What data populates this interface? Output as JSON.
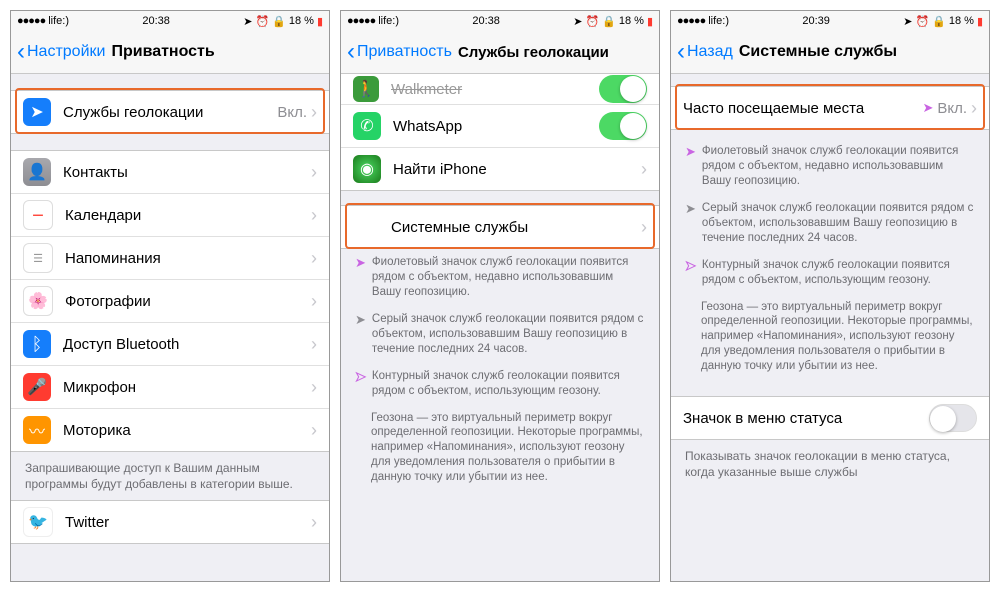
{
  "status": {
    "carrier": "life:)",
    "dots": "●●●●●",
    "time1": "20:38",
    "time2": "20:38",
    "time3": "20:39",
    "battery": "18 %"
  },
  "screen1": {
    "back": "Настройки",
    "title": "Приватность",
    "rows": [
      {
        "label": "Службы геолокации",
        "value": "Вкл.",
        "icon": "#157efb"
      },
      {
        "label": "Контакты",
        "icon": "#8e8e93"
      },
      {
        "label": "Календари",
        "icon": "#ffffff"
      },
      {
        "label": "Напоминания",
        "icon": "#ffffff"
      },
      {
        "label": "Фотографии",
        "icon": "#ffffff"
      },
      {
        "label": "Доступ Bluetooth",
        "icon": "#157efb"
      },
      {
        "label": "Микрофон",
        "icon": "#ff3b30"
      },
      {
        "label": "Моторика",
        "icon": "#ff9500"
      }
    ],
    "footer": "Запрашивающие доступ к Вашим данным программы будут добавлены в категории выше.",
    "twitter": "Twitter"
  },
  "screen2": {
    "back": "Приватность",
    "title": "Службы геолокации",
    "apps": [
      {
        "label": "Walkmeter"
      },
      {
        "label": "WhatsApp"
      },
      {
        "label": "Найти iPhone"
      }
    ],
    "system": "Системные службы",
    "info1": "Фиолетовый значок служб геолокации появится рядом с объектом, недавно использовавшим Вашу геопозицию.",
    "info2": "Серый значок служб геолокации появится рядом с объектом, использовавшим Вашу геопозицию в течение последних 24 часов.",
    "info3": "Контурный значок служб геолокации появится рядом с объектом, использующим геозону.",
    "geo": "Геозона — это виртуальный периметр вокруг определенной геопозиции. Некоторые программы, например «Напоминания», используют геозону для уведомления пользователя о прибытии в данную точку или убытии из нее."
  },
  "screen3": {
    "back": "Назад",
    "title": "Системные службы",
    "freq": "Часто посещаемые места",
    "freq_val": "Вкл.",
    "info1": "Фиолетовый значок служб геолокации появится рядом с объектом, недавно использовавшим Вашу геопозицию.",
    "info2": "Серый значок служб геолокации появится рядом с объектом, использовавшим Вашу геопозицию в течение последних 24 часов.",
    "info3": "Контурный значок служб геолокации появится рядом с объектом, использующим геозону.",
    "geo": "Геозона — это виртуальный периметр вокруг определенной геопозиции. Некоторые программы, например «Напоминания», используют геозону для уведомления пользователя о прибытии в данную точку или убытии из нее.",
    "status_label": "Значок в меню статуса",
    "status_footer": "Показывать значок геолокации в меню статуса, когда указанные выше службы"
  }
}
